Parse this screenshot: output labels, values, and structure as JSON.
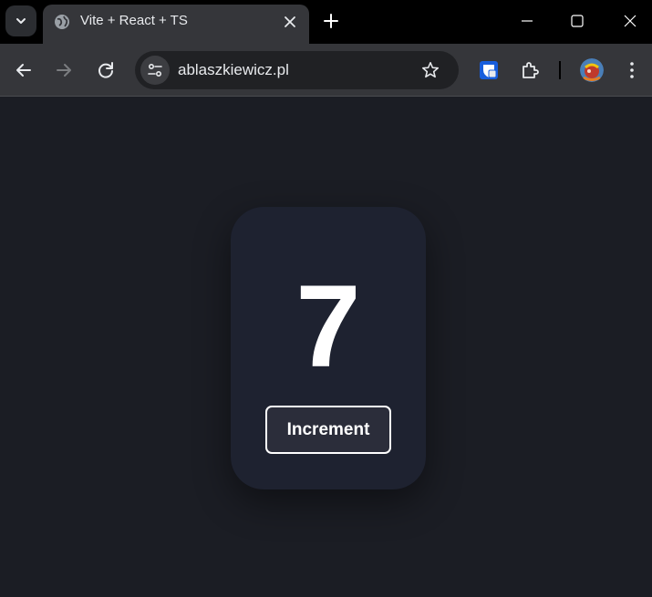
{
  "browser": {
    "tab": {
      "title": "Vite + React + TS",
      "favicon": "globe-icon"
    },
    "address_bar": {
      "url": "ablaszkiewicz.pl"
    },
    "toolbar_icons": [
      "back-icon",
      "forward-icon",
      "reload-icon",
      "site-info-icon",
      "star-icon",
      "bitwarden-extension-icon",
      "extensions-icon",
      "profile-avatar",
      "kebab-menu-icon"
    ],
    "window_controls": [
      "minimize-icon",
      "maximize-icon",
      "close-icon"
    ]
  },
  "app": {
    "counter_value": "7",
    "increment_label": "Increment"
  },
  "colors": {
    "page_background": "#1b1d24",
    "card_background": "#1e2230",
    "button_background": "#2b2d3a",
    "button_border": "#ffffff",
    "text": "#ffffff"
  }
}
